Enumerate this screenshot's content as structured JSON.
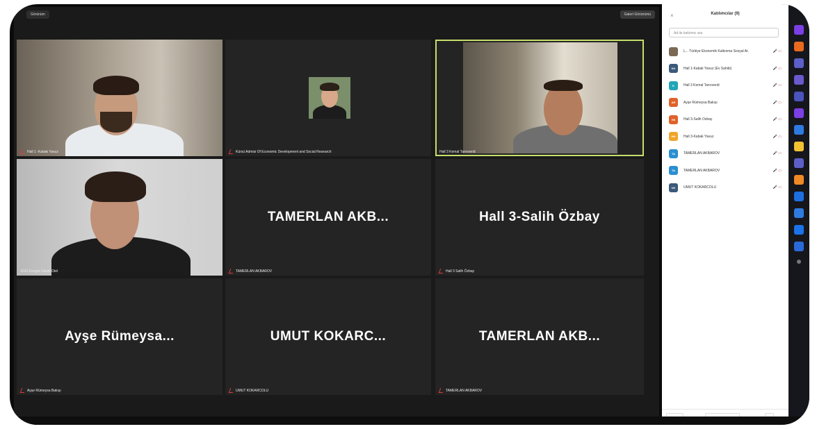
{
  "meeting": {
    "top_tag": "Görünüm",
    "view_button": "Galeri Görünümü"
  },
  "tiles": [
    {
      "name": "Hall 1 -Kabak Yavuz",
      "big": ""
    },
    {
      "name": "Kürsü Admisi Of Economic Development and Social Research",
      "big": ""
    },
    {
      "name": "Hall 3 Kemal Tanrıverdi",
      "big": ""
    },
    {
      "name": "EGS Kongre Farah Otel",
      "big": ""
    },
    {
      "name": "TAMERLAN AKBAROV",
      "big": "TAMERLAN  AKB..."
    },
    {
      "name": "Hall 3 Salih Özbay",
      "big": "Hall 3-Salih Özbay"
    },
    {
      "name": "Ayşe Rümeysa Bakışı",
      "big": "Ayşe  Rümeysa..."
    },
    {
      "name": "UMUT KOKARCOLU",
      "big": "UMUT  KOKARC..."
    },
    {
      "name": "TAMERLAN AKBAROV",
      "big": "TAMERLAN  AKB..."
    }
  ],
  "sidebar": {
    "close": "×",
    "title": "Katılımcılar (9)",
    "search_placeholder": "Ad ile katılımcı ara",
    "participants": [
      {
        "initials": "",
        "name": "L... Türkiye Ekonomik Kalkınma Sosyal Ar.",
        "color": "#7a6a55",
        "status": "🎤 ▭"
      },
      {
        "initials": "KK",
        "name": "Hall 1-Kabak Yavuz (Ev Sahibi)",
        "color": "#3b5a7a",
        "status": "🎤 ▭"
      },
      {
        "initials": "E",
        "name": "Hall 3 Kemal Tanrıverdi",
        "color": "#1fa6b8",
        "status": "🎤 ▭"
      },
      {
        "initials": "AR",
        "name": "Ayşe Rümeysa Bakışı",
        "color": "#e0612a",
        "status": "🎤 ▭"
      },
      {
        "initials": "HS",
        "name": "Hall 3-Salih Özbay",
        "color": "#e0612a",
        "status": "🎤 ▭"
      },
      {
        "initials": "HH",
        "name": "Hall 3-Kabak Yavuz",
        "color": "#f0a52a",
        "status": "🎤 ▭"
      },
      {
        "initials": "TA",
        "name": "TAMERLAN AKBAROV",
        "color": "#2a8fd1",
        "status": "🎤 ▭"
      },
      {
        "initials": "TA",
        "name": "TAMERLAN AKBAROV",
        "color": "#2a8fd1",
        "status": "🎤 ▭"
      },
      {
        "initials": "UK",
        "name": "UMUT KOKARCOLU",
        "color": "#3b5a7a",
        "status": "🎤 ▭"
      }
    ],
    "invite_button": "Davet Et",
    "mute_all_button": "Tümünün Sesini Kapat",
    "more_button": "..."
  },
  "colors": {
    "active_outline": "#c7df6b",
    "tile_bg": "#242424",
    "mute_red": "#e23b3b"
  }
}
